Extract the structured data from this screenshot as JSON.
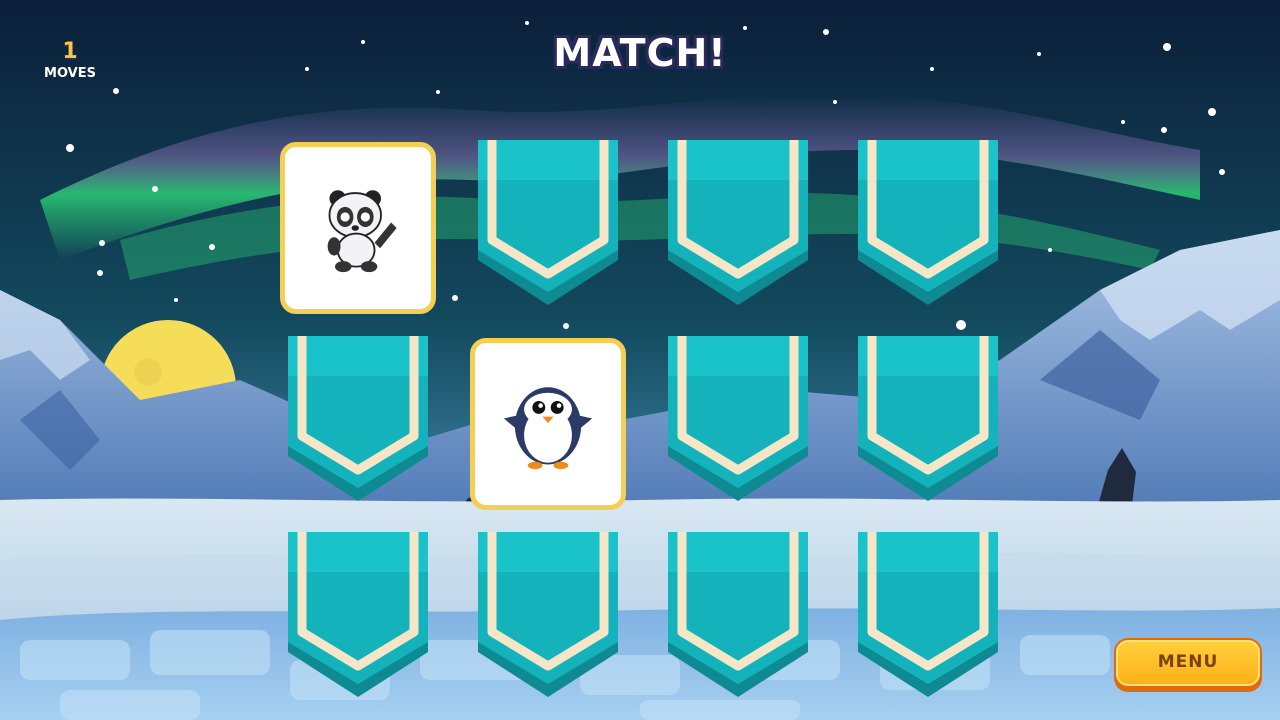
{
  "hud": {
    "moves_count": "1",
    "moves_label": "MOVES"
  },
  "title": "MATCH!",
  "grid": {
    "rows": 3,
    "cols": 4,
    "cards": [
      {
        "row": 1,
        "col": 1,
        "state": "revealed",
        "animal": "panda"
      },
      {
        "row": 1,
        "col": 2,
        "state": "hidden",
        "animal": ""
      },
      {
        "row": 1,
        "col": 3,
        "state": "hidden",
        "animal": ""
      },
      {
        "row": 1,
        "col": 4,
        "state": "hidden",
        "animal": ""
      },
      {
        "row": 2,
        "col": 1,
        "state": "hidden",
        "animal": ""
      },
      {
        "row": 2,
        "col": 2,
        "state": "revealed",
        "animal": "penguin"
      },
      {
        "row": 2,
        "col": 3,
        "state": "hidden",
        "animal": ""
      },
      {
        "row": 2,
        "col": 4,
        "state": "hidden",
        "animal": ""
      },
      {
        "row": 3,
        "col": 1,
        "state": "hidden",
        "animal": ""
      },
      {
        "row": 3,
        "col": 2,
        "state": "hidden",
        "animal": ""
      },
      {
        "row": 3,
        "col": 3,
        "state": "hidden",
        "animal": ""
      },
      {
        "row": 3,
        "col": 4,
        "state": "hidden",
        "animal": ""
      }
    ]
  },
  "menu_button": {
    "label": "MENU"
  },
  "colors": {
    "card_back": "#14b3bb",
    "card_trim": "#f6e6c8",
    "revealed_border": "#f4cf54",
    "menu_button": "#ffb118",
    "sky_top": "#0b1f3a",
    "aurora": "#2ee07a"
  },
  "icons": {
    "card_revealed_1": "panda-icon",
    "card_revealed_2": "penguin-icon",
    "scene": "arctic-night-scene"
  }
}
